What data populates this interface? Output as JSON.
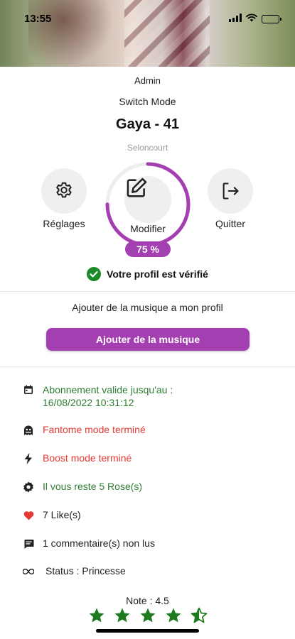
{
  "status_bar": {
    "time": "13:55"
  },
  "profile": {
    "role": "Admin",
    "switch_mode": "Switch Mode",
    "name": "Gaya - 41",
    "city": "Seloncourt"
  },
  "actions": {
    "settings_label": "Réglages",
    "edit_label": "Modifier",
    "quit_label": "Quitter",
    "completion": "75 %",
    "completion_value": 0.75
  },
  "verified": {
    "text": "Votre profil est vérifié"
  },
  "music": {
    "prompt": "Ajouter de la musique a mon profil",
    "button_label": "Ajouter de la musique"
  },
  "info": [
    {
      "icon": "calendar-icon",
      "text": "Abonnement valide jusqu'au :\n16/08/2022 10:31:12",
      "color": "#2e7d32"
    },
    {
      "icon": "ghost-icon",
      "text": "Fantome mode terminé",
      "color": "#e53935"
    },
    {
      "icon": "bolt-icon",
      "text": "Boost mode terminé",
      "color": "#e53935"
    },
    {
      "icon": "badge-icon",
      "text": "Il vous reste 5 Rose(s)",
      "color": "#2e7d32"
    },
    {
      "icon": "heart-icon",
      "text": "7 Like(s)",
      "color": "#222222"
    },
    {
      "icon": "comment-icon",
      "text": "1 commentaire(s) non lus",
      "color": "#222222"
    },
    {
      "icon": "infinity-icon",
      "text": "Status : Princesse",
      "color": "#222222"
    }
  ],
  "rating": {
    "label": "Note : 4.5",
    "value": 4.5,
    "max": 5
  },
  "colors": {
    "accent": "#a33fb1",
    "green": "#2e7d32",
    "red": "#e53935",
    "star": "#1e7a1e"
  }
}
